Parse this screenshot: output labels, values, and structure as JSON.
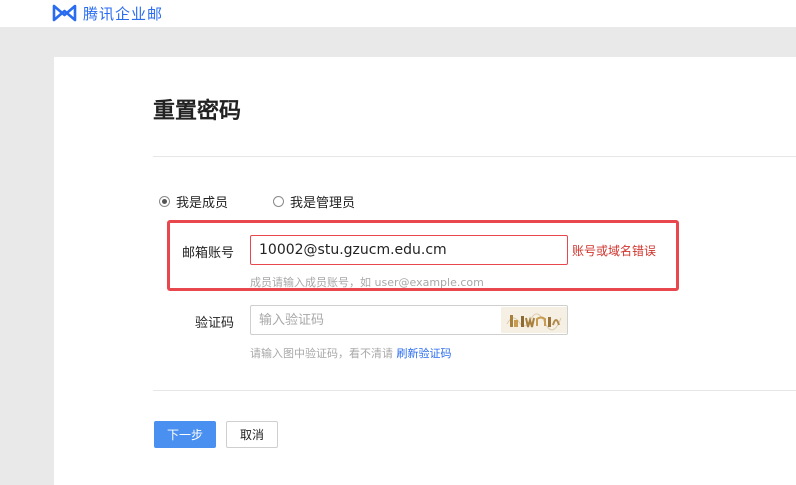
{
  "app": {
    "logo_text": "腾讯企业邮",
    "brand_color": "#2a6cf0"
  },
  "page": {
    "title": "重置密码"
  },
  "role_options": [
    {
      "label": "我是成员",
      "checked": true
    },
    {
      "label": "我是管理员",
      "checked": false
    }
  ],
  "form": {
    "email": {
      "label": "邮箱账号",
      "value": "10002@stu.gzucm.edu.cm",
      "error": "账号或域名错误",
      "hint": "成员请输入成员账号，如 user@example.com"
    },
    "captcha": {
      "label": "验证码",
      "placeholder": "输入验证码",
      "hint_prefix": "请输入图中验证码，看不清请",
      "refresh_link": "刷新验证码"
    }
  },
  "actions": {
    "next_label": "下一步",
    "cancel_label": "取消"
  },
  "colors": {
    "error": "#e8474e",
    "primary_button": "#4a90f0",
    "link": "#2a6cf0"
  }
}
